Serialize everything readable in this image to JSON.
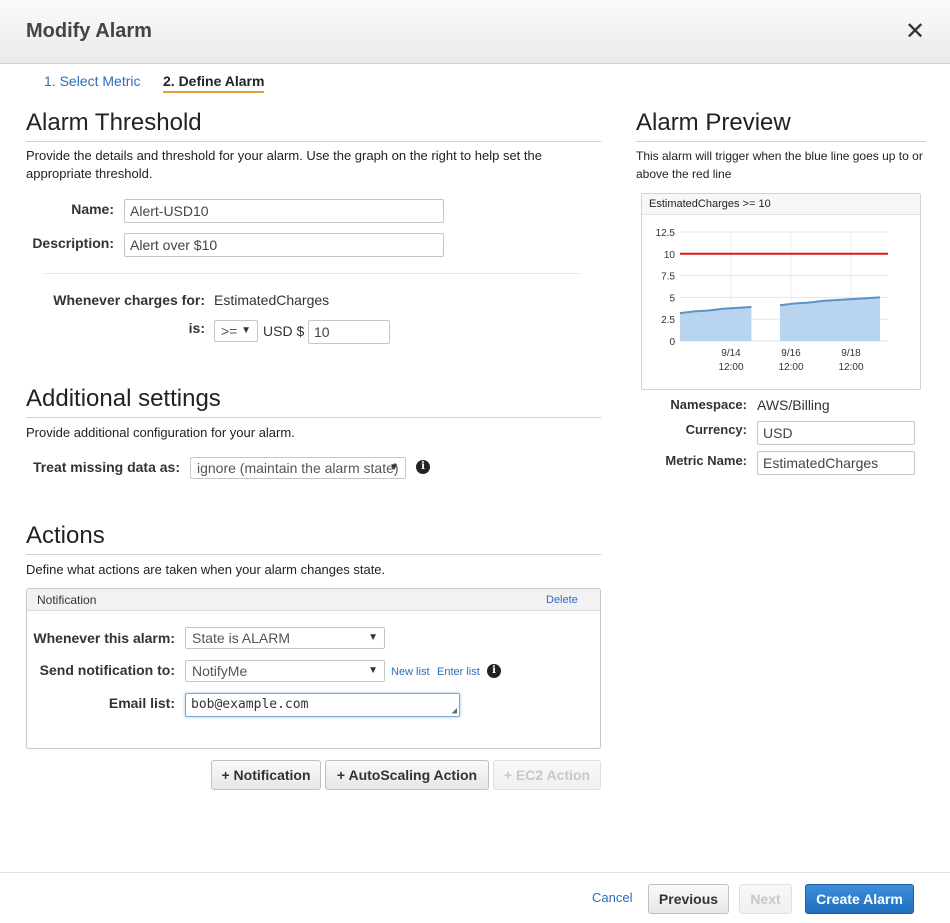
{
  "header": {
    "title": "Modify Alarm",
    "close_glyph": "✕"
  },
  "steps": [
    "1. Select Metric",
    "2. Define Alarm"
  ],
  "threshold": {
    "heading": "Alarm Threshold",
    "description": "Provide the details and threshold for your alarm. Use the graph on the right to help set the appropriate threshold.",
    "name_label": "Name:",
    "name_value": "Alert-USD10",
    "desc_label": "Description:",
    "desc_value": "Alert over $10",
    "charges_label": "Whenever charges for:",
    "charges_value": "EstimatedCharges",
    "is_label": "is:",
    "operator": ">=",
    "currency_prefix": "USD $",
    "threshold_value": "10"
  },
  "additional": {
    "heading": "Additional settings",
    "description": "Provide additional configuration for your alarm.",
    "missing_label": "Treat missing data as:",
    "missing_value": "ignore (maintain the alarm state)"
  },
  "actions": {
    "heading": "Actions",
    "description": "Define what actions are taken when your alarm changes state.",
    "notification": {
      "title": "Notification",
      "delete": "Delete",
      "state_label": "Whenever this alarm:",
      "state_value": "State is ALARM",
      "send_label": "Send notification to:",
      "send_value": "NotifyMe",
      "new_list": "New list",
      "enter_list": "Enter list",
      "email_label": "Email list:",
      "email_value": "bob@example.com"
    },
    "buttons": [
      "+ Notification",
      "+ AutoScaling Action",
      "+ EC2 Action"
    ]
  },
  "preview": {
    "heading": "Alarm Preview",
    "description": "This alarm will trigger when the blue line goes up to or above the red line",
    "chart_title": "EstimatedCharges >= 10",
    "namespace_label": "Namespace:",
    "namespace_value": "AWS/Billing",
    "currency_label": "Currency:",
    "currency_value": "USD",
    "metric_label": "Metric Name:",
    "metric_value": "EstimatedCharges"
  },
  "footer": {
    "cancel": "Cancel",
    "previous": "Previous",
    "next": "Next",
    "create": "Create Alarm"
  },
  "colors": {
    "accent": "#1e6fbd",
    "threshold_line": "#e0161b",
    "series_line": "#5b93c8",
    "series_fill": "#b9d4ef",
    "step_underline": "#e8a13a"
  },
  "chart_data": {
    "type": "area",
    "title": "EstimatedCharges >= 10",
    "y_ticks": [
      "12.5",
      "10",
      "7.5",
      "5",
      "2.5",
      "0"
    ],
    "ylim": [
      0,
      12.5
    ],
    "x_ticks": [
      [
        "9/14",
        "12:00"
      ],
      [
        "9/16",
        "12:00"
      ],
      [
        "9/18",
        "12:00"
      ]
    ],
    "series": [
      {
        "values": [
          3.2,
          3.4,
          3.5,
          3.7,
          3.8,
          3.9,
          null,
          4.1,
          4.3,
          4.4,
          4.6,
          4.7,
          4.8,
          4.9,
          5.0
        ]
      }
    ],
    "threshold": 10,
    "grid": true
  }
}
